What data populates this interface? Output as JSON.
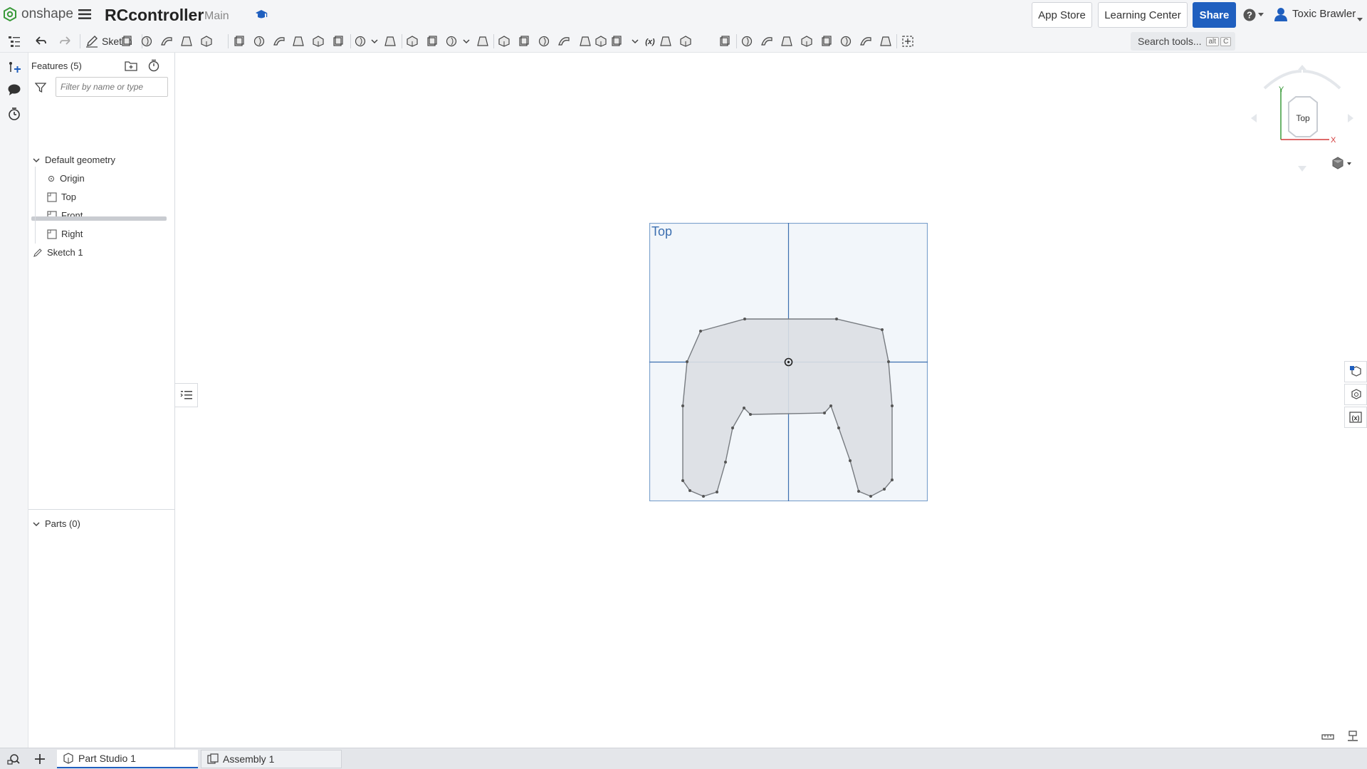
{
  "topbar": {
    "logo_text": "onshape",
    "doc_title": "RCcontroller",
    "branch": "Main",
    "app_store": "App Store",
    "learning_center": "Learning Center",
    "share": "Share",
    "user_name": "Toxic Brawler"
  },
  "toolbar": {
    "sketch_label": "Sketch",
    "search_label": "Search tools...",
    "kbd_alt": "alt",
    "kbd_c": "C",
    "variable_label": "(x)"
  },
  "panel": {
    "features_title": "Features (5)",
    "filter_placeholder": "Filter by name or type",
    "default_geometry": "Default geometry",
    "items": [
      {
        "label": "Origin"
      },
      {
        "label": "Top"
      },
      {
        "label": "Front"
      },
      {
        "label": "Right"
      }
    ],
    "sketch_item": "Sketch 1",
    "parts_title": "Parts (0)"
  },
  "viewport": {
    "plane_label": "Top",
    "view_cube_label": "Top",
    "axis_y": "Y",
    "axis_x": "X"
  },
  "tabs": [
    {
      "label": "Part Studio 1"
    },
    {
      "label": "Assembly 1"
    }
  ],
  "colors": {
    "accent": "#1f5fbf",
    "plane_fill": "#f2f6fa",
    "plane_stroke": "#7aa0cc",
    "sketch_fill": "#dcdfe3",
    "sketch_stroke": "#777b80",
    "axis_red": "#d33a3a",
    "axis_green": "#3a9a3a"
  }
}
